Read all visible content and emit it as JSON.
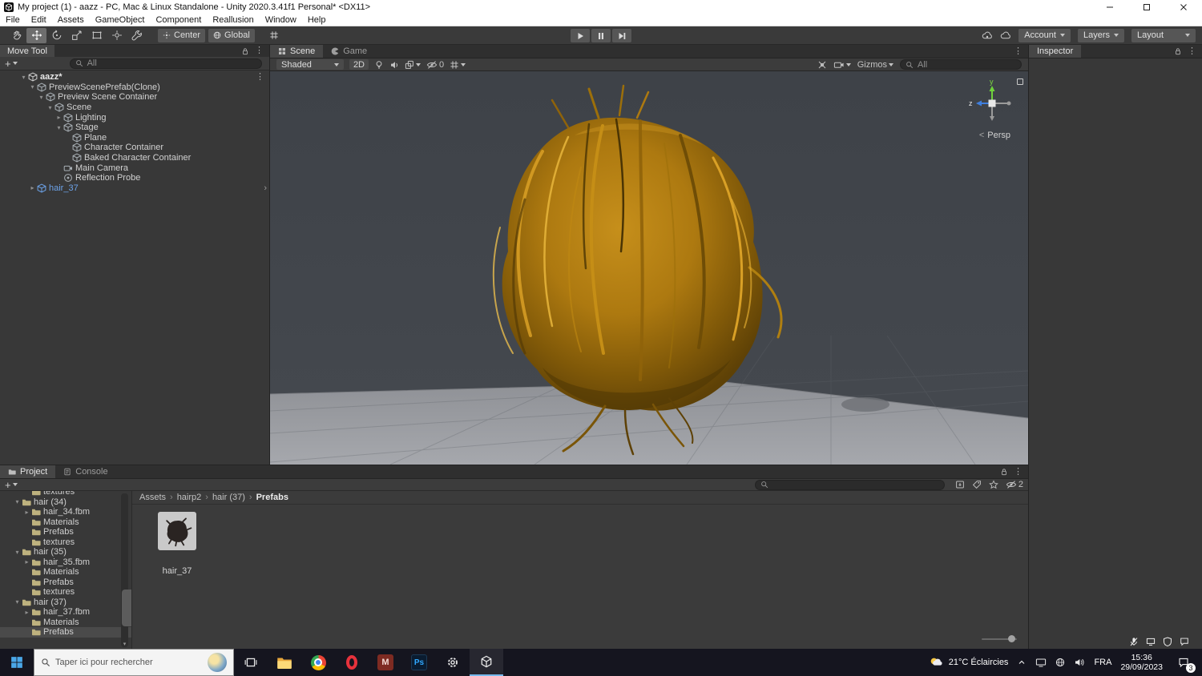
{
  "window": {
    "title": "My project (1) - aazz - PC, Mac & Linux Standalone - Unity 2020.3.41f1 Personal* <DX11>",
    "menus": [
      "File",
      "Edit",
      "Assets",
      "GameObject",
      "Component",
      "Reallusion",
      "Window",
      "Help"
    ]
  },
  "toolbar": {
    "tooltip": "Move Tool",
    "center": "Center",
    "global": "Global",
    "account": "Account",
    "layers": "Layers",
    "layout": "Layout"
  },
  "hierarchy": {
    "search_value": "All",
    "rows": [
      {
        "label": "aazz*"
      },
      {
        "label": "PreviewScenePrefab(Clone)"
      },
      {
        "label": "Preview Scene Container"
      },
      {
        "label": "Scene"
      },
      {
        "label": "Lighting"
      },
      {
        "label": "Stage"
      },
      {
        "label": "Plane"
      },
      {
        "label": "Character Container"
      },
      {
        "label": "Baked Character Container"
      },
      {
        "label": "Main Camera"
      },
      {
        "label": "Reflection Probe"
      },
      {
        "label": "hair_37"
      }
    ]
  },
  "scene": {
    "tab_scene": "Scene",
    "tab_game": "Game",
    "shading": "Shaded",
    "mode_2d": "2D",
    "hidden_count": "0",
    "gizmos": "Gizmos",
    "search_value": "All",
    "axis_y": "y",
    "axis_z": "z",
    "projection": "Persp"
  },
  "inspector": {
    "title": "Inspector"
  },
  "project": {
    "tab_project": "Project",
    "tab_console": "Console",
    "breadcrumb": [
      "Assets",
      "hairp2",
      "hair (37)",
      "Prefabs"
    ],
    "tree": [
      {
        "label": "textures"
      },
      {
        "label": "hair (34)"
      },
      {
        "label": "hair_34.fbm"
      },
      {
        "label": "Materials"
      },
      {
        "label": "Prefabs"
      },
      {
        "label": "textures"
      },
      {
        "label": "hair (35)"
      },
      {
        "label": "hair_35.fbm"
      },
      {
        "label": "Materials"
      },
      {
        "label": "Prefabs"
      },
      {
        "label": "textures"
      },
      {
        "label": "hair (37)"
      },
      {
        "label": "hair_37.fbm"
      },
      {
        "label": "Materials"
      },
      {
        "label": "Prefabs"
      }
    ],
    "asset_label": "hair_37",
    "eye_count": "2"
  },
  "taskbar": {
    "search_placeholder": "Taper ici pour rechercher",
    "weather": "21°C Éclaircies",
    "language": "FRA",
    "time": "15:36",
    "date": "29/09/2023",
    "badge": "3"
  }
}
